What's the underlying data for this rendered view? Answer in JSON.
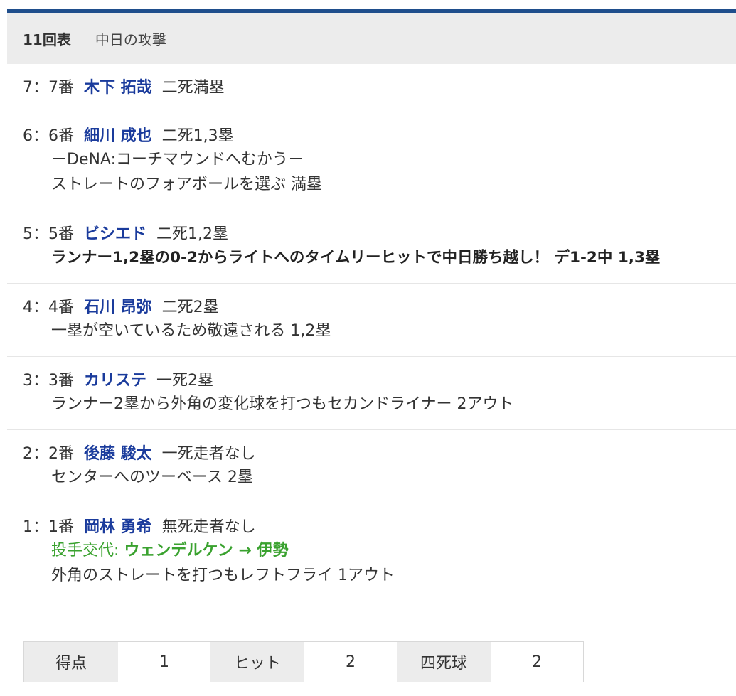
{
  "header": {
    "inning": "11回表",
    "team": "中日の攻撃"
  },
  "plays": [
    {
      "order": "7：7番",
      "batter": "木下 拓哉",
      "situation": "二死満塁",
      "details": []
    },
    {
      "order": "6：6番",
      "batter": "細川 成也",
      "situation": "二死1,3塁",
      "details": [
        "－DeNA:コーチマウンドへむかう－",
        "ストレートのフォアボールを選ぶ 満塁"
      ]
    },
    {
      "order": "5：5番",
      "batter": "ビシエド",
      "situation": "二死1,2塁",
      "details": [
        "ランナー1,2塁の0-2からライトへのタイムリーヒットで中日勝ち越し！ デ1-2中 1,3塁"
      ]
    },
    {
      "order": "4：4番",
      "batter": "石川 昂弥",
      "situation": "二死2塁",
      "details": [
        "一塁が空いているため敬遠される 1,2塁"
      ]
    },
    {
      "order": "3：3番",
      "batter": "カリステ",
      "situation": "一死2塁",
      "details": [
        "ランナー2塁から外角の変化球を打つもセカンドライナー 2アウト"
      ]
    },
    {
      "order": "2：2番",
      "batter": "後藤 駿太",
      "situation": "一死走者なし",
      "details": [
        "センターへのツーベース 2塁"
      ]
    },
    {
      "order": "1：1番",
      "batter": "岡林 勇希",
      "situation": "無死走者なし",
      "pitching_change": {
        "label": "投手交代: ",
        "names": "ウェンデルケン → 伊勢"
      },
      "details": [
        "外角のストレートを打つもレフトフライ 1アウト"
      ]
    }
  ],
  "summary": [
    {
      "label": "得点",
      "value": "1"
    },
    {
      "label": "ヒット",
      "value": "2"
    },
    {
      "label": "四死球",
      "value": "2"
    }
  ],
  "colors": {
    "header_bar": "#1f4e8c",
    "batter_name": "#1a3b9c",
    "pitching_change": "#3aa22f"
  }
}
